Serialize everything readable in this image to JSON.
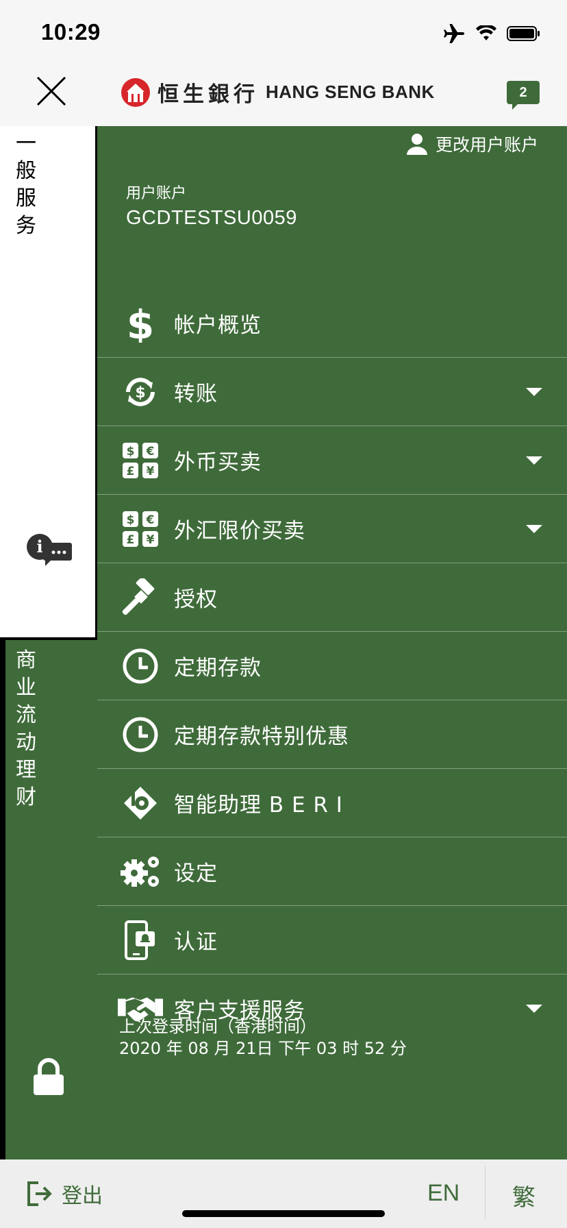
{
  "status_bar": {
    "time": "10:29"
  },
  "header": {
    "close_icon": "close-icon",
    "logo_cn": "恒生銀行",
    "logo_en": "HANG SENG BANK",
    "notification_count": "2"
  },
  "side_tabs": {
    "general_services": [
      "一",
      "般",
      "服",
      "务"
    ],
    "business_wealth": [
      "商",
      "业",
      "流",
      "动",
      "理",
      "财"
    ]
  },
  "account": {
    "switch_label": "更改用户账户",
    "label": "用户账户",
    "id": "GCDTESTSU0059"
  },
  "menu": [
    {
      "label": "帐户概览",
      "icon": "dollar-icon",
      "expandable": false
    },
    {
      "label": "转账",
      "icon": "transfer-icon",
      "expandable": true
    },
    {
      "label": "外币买卖",
      "icon": "currency-exchange-icon",
      "expandable": true
    },
    {
      "label": "外汇限价买卖",
      "icon": "currency-limit-icon",
      "expandable": true
    },
    {
      "label": "授权",
      "icon": "gavel-icon",
      "expandable": false
    },
    {
      "label": "定期存款",
      "icon": "clock-icon",
      "expandable": false
    },
    {
      "label": "定期存款特别优惠",
      "icon": "clock-icon",
      "expandable": false
    },
    {
      "label": "智能助理 B E R I",
      "icon": "beri-icon",
      "expandable": false
    },
    {
      "label": "设定",
      "icon": "gears-icon",
      "expandable": false
    },
    {
      "label": "认证",
      "icon": "mobile-auth-icon",
      "expandable": false
    },
    {
      "label": "客户支援服务",
      "icon": "handshake-icon",
      "expandable": true
    }
  ],
  "last_login": {
    "label": "上次登录时间（香港时间）",
    "value": "2020 年 08 月 21日 下午 03 时 52 分"
  },
  "footer": {
    "logout": "登出",
    "lang_en": "EN",
    "lang_tc": "繁"
  },
  "colors": {
    "brand_green": "#3f6b3a",
    "footer_bg": "#eeeeee"
  }
}
